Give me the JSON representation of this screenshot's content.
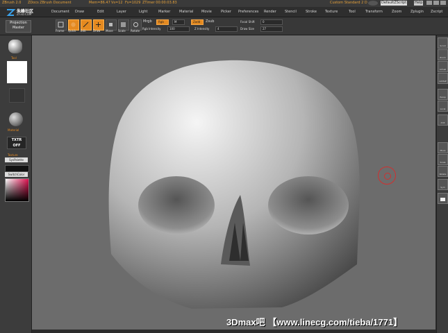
{
  "titlebar": {
    "app": "ZBrush 2.0",
    "document": "ZDocs ZBrush Document",
    "mem": "Mem=86.47",
    "vs": "Vs=12",
    "fs": "Fs=1029",
    "ztimer": "ZTimer 00:00:03.83",
    "custom": "Custom Standard 2 D",
    "default": "DefaultZScript",
    "help": "Help"
  },
  "brand": {
    "name": "朱峰社区",
    "sub": "ZF3D.COM"
  },
  "menu": [
    "Document",
    "Draw",
    "Edit",
    "Layer",
    "Light",
    "Marker",
    "Material",
    "Movie",
    "Picker",
    "Preferences",
    "Render",
    "Stencil",
    "Stroke",
    "Texture",
    "Tool",
    "Transform",
    "Zoom",
    "Zplugin",
    "Zscript"
  ],
  "shelf": {
    "projection_master": "Projection Master",
    "tools": [
      "Frame",
      "Quick",
      "Edit",
      "Draw",
      "Move",
      "Scale",
      "Rotate"
    ],
    "mrgb": "Mrgb",
    "rgb": "Rgb",
    "m": "M",
    "zadd": "Zadd",
    "zsub": "Zsub",
    "rgb_intensity_label": "Rgb Intensity",
    "rgb_intensity_value": "100",
    "z_intensity_label": "Z Intensity",
    "z_intensity_value": "4",
    "focal_shift_label": "Focal Shift",
    "focal_shift_value": "0",
    "draw_size_label": "Draw Size",
    "draw_size_value": "27"
  },
  "left": {
    "tool_label": "Tool",
    "material_label": "Material",
    "txtr_off": "TXTR OFF",
    "texture_label": "Texture",
    "syspalette": "SysPalette",
    "switchcolor": "SwitchColor"
  },
  "right": [
    "Scroll",
    "Zoom",
    "Actual",
    "AAHalf",
    "Persp",
    "Local",
    "XYZ",
    "Move",
    "Scale",
    "Rotate",
    "Sym"
  ],
  "watermark": "3Dmax吧 【www.linecg.com/tieba/1771】"
}
